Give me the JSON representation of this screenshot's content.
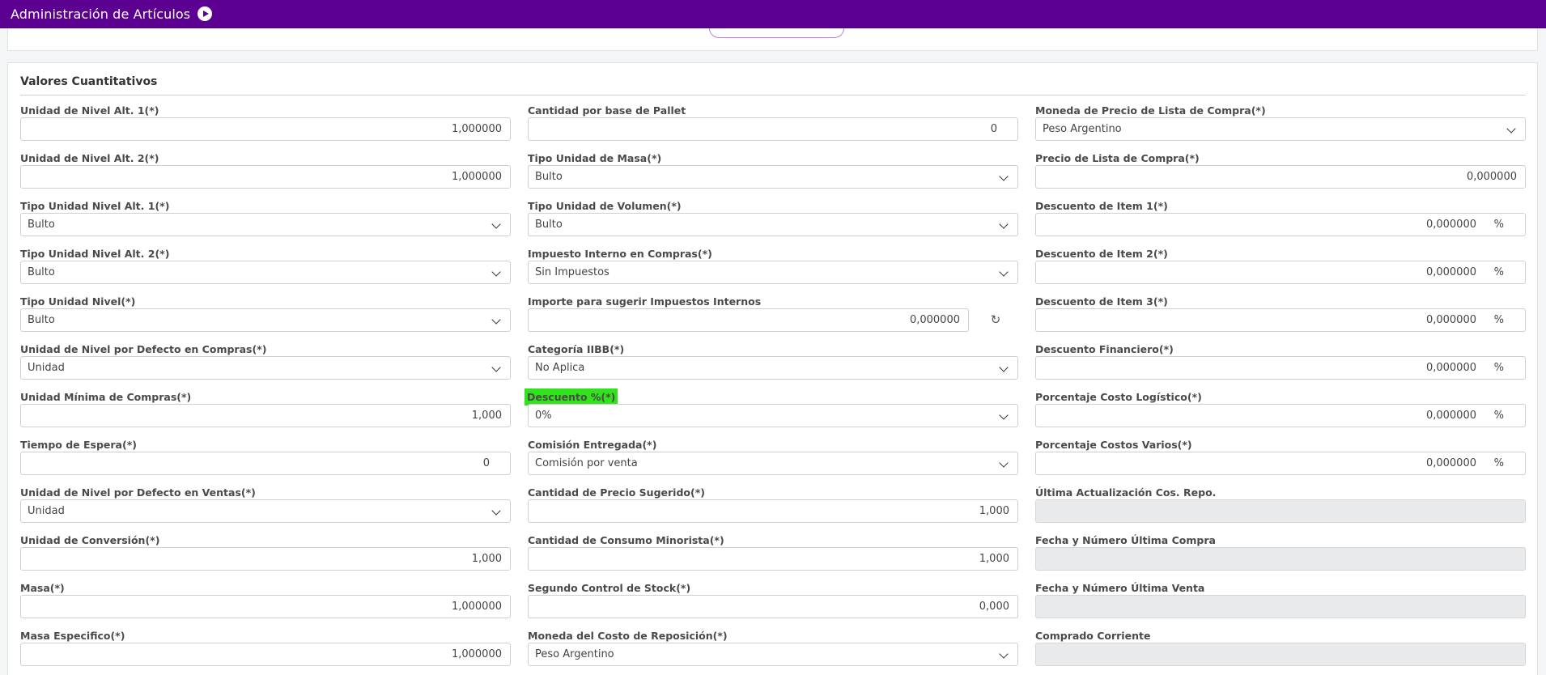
{
  "header": {
    "title": "Administración de Artículos"
  },
  "section": {
    "title": "Valores Cuantitativos"
  },
  "fields": {
    "unidad_nivel_alt1": {
      "label": "Unidad de Nivel Alt. 1(*)",
      "value": "1,000000"
    },
    "unidad_nivel_alt2": {
      "label": "Unidad de Nivel Alt. 2(*)",
      "value": "1,000000"
    },
    "tipo_unidad_nivel_alt1": {
      "label": "Tipo Unidad Nivel Alt. 1(*)",
      "value": "Bulto"
    },
    "tipo_unidad_nivel_alt2": {
      "label": "Tipo Unidad Nivel Alt. 2(*)",
      "value": "Bulto"
    },
    "tipo_unidad_nivel": {
      "label": "Tipo Unidad Nivel(*)",
      "value": "Bulto"
    },
    "unidad_defecto_compras": {
      "label": "Unidad de Nivel por Defecto en Compras(*)",
      "value": "Unidad"
    },
    "unidad_minima_compras": {
      "label": "Unidad Mínima de Compras(*)",
      "value": "1,000"
    },
    "tiempo_espera": {
      "label": "Tiempo de Espera(*)",
      "value": "0"
    },
    "unidad_defecto_ventas": {
      "label": "Unidad de Nivel por Defecto en Ventas(*)",
      "value": "Unidad"
    },
    "unidad_conversion": {
      "label": "Unidad de Conversión(*)",
      "value": "1,000"
    },
    "masa": {
      "label": "Masa(*)",
      "value": "1,000000"
    },
    "masa_especifico": {
      "label": "Masa Especifico(*)",
      "value": "1,000000"
    },
    "cantidad_base_pallet": {
      "label": "Cantidad por base de Pallet",
      "value": "0"
    },
    "tipo_unidad_masa": {
      "label": "Tipo Unidad de Masa(*)",
      "value": "Bulto"
    },
    "tipo_unidad_volumen": {
      "label": "Tipo Unidad de Volumen(*)",
      "value": "Bulto"
    },
    "impuesto_interno_compras": {
      "label": "Impuesto Interno en Compras(*)",
      "value": "Sin Impuestos"
    },
    "importe_sugerir_impuestos": {
      "label": "Importe para sugerir Impuestos Internos",
      "value": "0,000000"
    },
    "categoria_iibb": {
      "label": "Categoría IIBB(*)",
      "value": "No Aplica"
    },
    "descuento_pct": {
      "label": "Descuento %(*)",
      "value": "0%"
    },
    "comision_entregada": {
      "label": "Comisión Entregada(*)",
      "value": "Comisión por venta"
    },
    "cantidad_precio_sugerido": {
      "label": "Cantidad de Precio Sugerido(*)",
      "value": "1,000"
    },
    "cantidad_consumo_minorista": {
      "label": "Cantidad de Consumo Minorista(*)",
      "value": "1,000"
    },
    "segundo_control_stock": {
      "label": "Segundo Control de Stock(*)",
      "value": "0,000"
    },
    "moneda_costo_reposicion": {
      "label": "Moneda del Costo de Reposición(*)",
      "value": "Peso Argentino"
    },
    "moneda_precio_lista_compra": {
      "label": "Moneda de Precio de Lista de Compra(*)",
      "value": "Peso Argentino"
    },
    "precio_lista_compra": {
      "label": "Precio de Lista de Compra(*)",
      "value": "0,000000"
    },
    "descuento_item1": {
      "label": "Descuento de Item 1(*)",
      "value": "0,000000",
      "unit": "%"
    },
    "descuento_item2": {
      "label": "Descuento de Item 2(*)",
      "value": "0,000000",
      "unit": "%"
    },
    "descuento_item3": {
      "label": "Descuento de Item 3(*)",
      "value": "0,000000",
      "unit": "%"
    },
    "descuento_financiero": {
      "label": "Descuento Financiero(*)",
      "value": "0,000000",
      "unit": "%"
    },
    "porcentaje_costo_logistico": {
      "label": "Porcentaje Costo Logístico(*)",
      "value": "0,000000",
      "unit": "%"
    },
    "porcentaje_costos_varios": {
      "label": "Porcentaje Costos Varios(*)",
      "value": "0,000000",
      "unit": "%"
    },
    "ultima_actualizacion_cos_repo": {
      "label": "Última Actualización Cos. Repo.",
      "value": ""
    },
    "fecha_numero_ultima_compra": {
      "label": "Fecha y Número Última Compra",
      "value": ""
    },
    "fecha_numero_ultima_venta": {
      "label": "Fecha y Número Última Venta",
      "value": ""
    },
    "comprado_corriente": {
      "label": "Comprado Corriente",
      "value": ""
    }
  },
  "icons": {
    "header_play": "play-circle-icon",
    "refresh": "refresh-icon",
    "select_arrow": "chevron-down-icon"
  },
  "colors": {
    "header_bg": "#5b0091",
    "highlight": "#31e31b"
  }
}
